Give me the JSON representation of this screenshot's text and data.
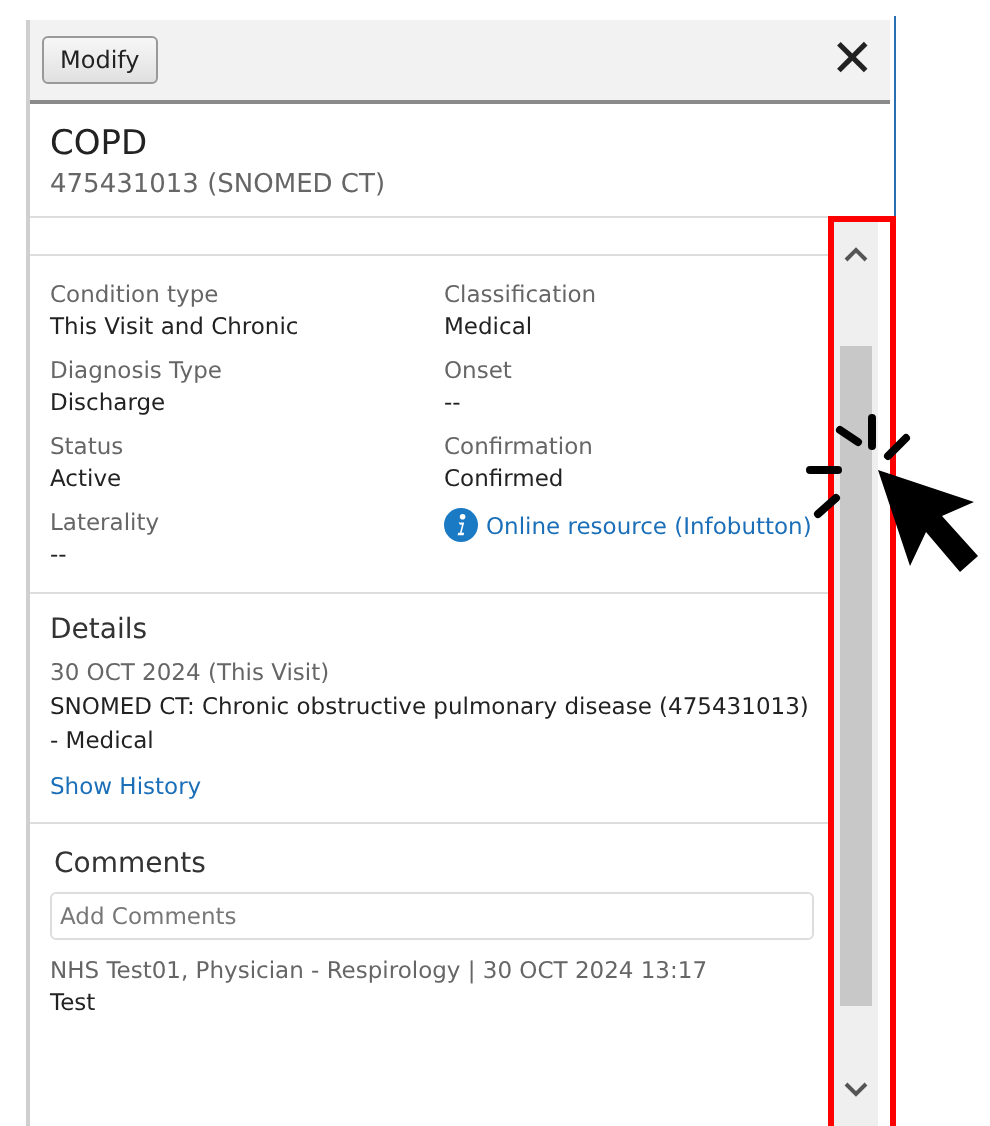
{
  "toolbar": {
    "modify_button": "Modify",
    "close_glyph": "✕"
  },
  "condition": {
    "title": "COPD",
    "code": "475431013 (SNOMED CT)"
  },
  "fields": [
    {
      "label": "Condition type",
      "value": "This Visit and Chronic"
    },
    {
      "label": "Classification",
      "value": "Medical"
    },
    {
      "label": "Diagnosis Type",
      "value": "Discharge"
    },
    {
      "label": "Onset",
      "value": "--"
    },
    {
      "label": "Status",
      "value": "Active"
    },
    {
      "label": "Confirmation",
      "value": "Confirmed"
    },
    {
      "label": "Laterality",
      "value": "--"
    }
  ],
  "infobutton_link": "Online resource (Infobutton)",
  "details": {
    "heading": "Details",
    "date": "30 OCT 2024 (This Visit)",
    "description": "SNOMED CT: Chronic obstructive pulmonary disease (475431013) - Medical",
    "link": "Show History"
  },
  "comments": {
    "heading": "Comments",
    "placeholder": "Add Comments",
    "entries": [
      {
        "author": "NHS Test01, Physician - Respirology | 30 OCT 2024 13:17",
        "text": "Test"
      }
    ]
  }
}
